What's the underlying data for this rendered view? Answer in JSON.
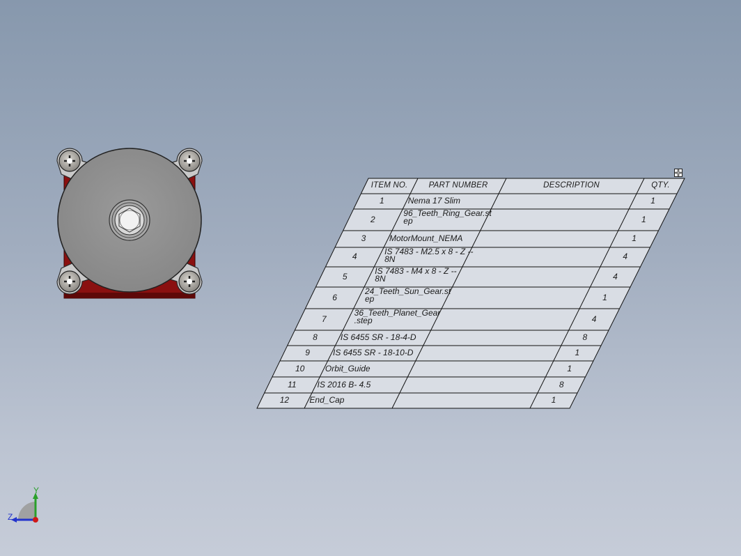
{
  "bom": {
    "headers": {
      "item_no": "ITEM NO.",
      "part_number": "PART NUMBER",
      "description": "DESCRIPTION",
      "qty": "QTY."
    },
    "rows": [
      {
        "item": "1",
        "part": "Nema 17 Slim",
        "description": "",
        "qty": "1"
      },
      {
        "item": "2",
        "part": "96_Teeth_Ring_Gear.st\nep",
        "description": "",
        "qty": "1"
      },
      {
        "item": "3",
        "part": "MotorMount_NEMA",
        "description": "",
        "qty": "1"
      },
      {
        "item": "4",
        "part": "IS 7483 - M2.5 x 8 - Z --\n8N",
        "description": "",
        "qty": "4"
      },
      {
        "item": "5",
        "part": "IS 7483 - M4 x 8 - Z --\n8N",
        "description": "",
        "qty": "4"
      },
      {
        "item": "6",
        "part": "24_Teeth_Sun_Gear.st\nep",
        "description": "",
        "qty": "1"
      },
      {
        "item": "7",
        "part": "36_Teeth_Planet_Gear\n.step",
        "description": "",
        "qty": "4"
      },
      {
        "item": "8",
        "part": "IS 6455 SR - 18-4-D",
        "description": "",
        "qty": "8"
      },
      {
        "item": "9",
        "part": "IS 6455 SR - 18-10-D",
        "description": "",
        "qty": "1"
      },
      {
        "item": "10",
        "part": "Orbit_Guide",
        "description": "",
        "qty": "1"
      },
      {
        "item": "11",
        "part": "IS 2016 B- 4.5",
        "description": "",
        "qty": "8"
      },
      {
        "item": "12",
        "part": "End_Cap",
        "description": "",
        "qty": "1"
      }
    ]
  },
  "triad": {
    "y_label": "Y",
    "z_label": "Z"
  },
  "colors": {
    "background_top": "#8798ad",
    "background_bottom": "#c6ccd8",
    "table_fill": "#d9dde4",
    "motor_face": "#8f8f8f",
    "mount_red": "#8a1010",
    "axis_y": "#2aa02a",
    "axis_z": "#2233cc",
    "axis_origin": "#d01818"
  },
  "icons": {
    "table_handle": "move-handle-icon",
    "screw": "phillips-screw-icon",
    "triad": "coordinate-triad-icon"
  }
}
